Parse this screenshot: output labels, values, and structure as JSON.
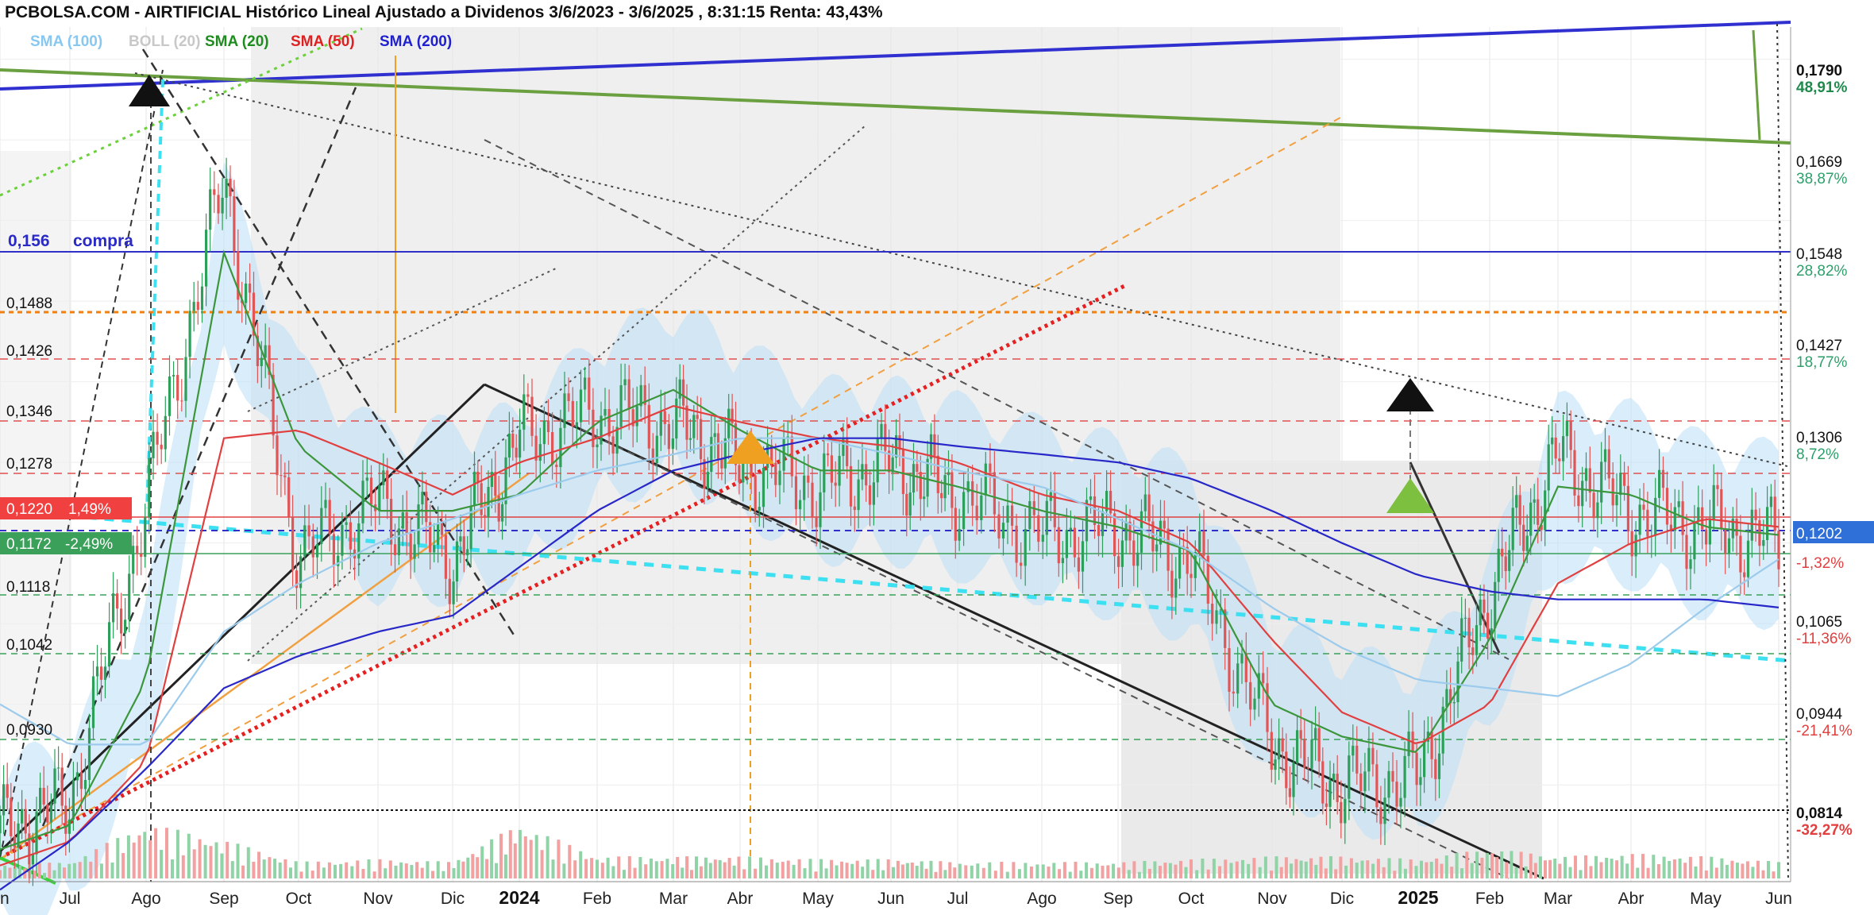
{
  "header": {
    "title": "PCBOLSA.COM - AIRTIFICIAL Histórico Lineal Ajustado a Dividenos 3/6/2023 - 3/6/2025 , 8:31:15 Renta: 43,43%"
  },
  "legend": [
    {
      "label": "SMA (100)",
      "color": "#87c8f0"
    },
    {
      "label": "BOLL (20)",
      "color": "#c8c8c8"
    },
    {
      "label": "SMA (20)",
      "color": "#1e8c1e"
    },
    {
      "label": "SMA (50)",
      "color": "#e02020"
    },
    {
      "label": "SMA (200)",
      "color": "#2020d0"
    }
  ],
  "colors": {
    "up": "#2e9e5b",
    "down": "#e05555",
    "sma20": "#3c963c",
    "sma50": "#e04040",
    "sma100": "#9ccbec",
    "sma200": "#2828c8",
    "boll": "#bcdff7",
    "channel": "#d8d8d8"
  },
  "annotations": {
    "compra_price": "0,156",
    "compra_label": "compra",
    "last_price": "0,1202",
    "level_1220": "0,1220",
    "level_1220_pct": "1,49%",
    "level_1172": "0,1172",
    "level_1172_pct": "-2,49%"
  },
  "right_axis": [
    {
      "price": "0,1790",
      "pct": "48,91%",
      "pct_color": "#1f8a4c",
      "bold": true
    },
    {
      "price": "0,1669",
      "pct": "38,87%",
      "pct_color": "#2e9e6a",
      "bold": false
    },
    {
      "price": "0,1548",
      "pct": "28,82%",
      "pct_color": "#2e9e6a",
      "bold": false
    },
    {
      "price": "0,1427",
      "pct": "18,77%",
      "pct_color": "#2e9e6a",
      "bold": false
    },
    {
      "price": "0,1306",
      "pct": "8,72%",
      "pct_color": "#2e9e6a",
      "bold": false
    },
    {
      "price": "",
      "pct": "-1,32%",
      "pct_color": "#e04040",
      "bold": false
    },
    {
      "price": "0,1065",
      "pct": "-11,36%",
      "pct_color": "#e04040",
      "bold": false
    },
    {
      "price": "0,0944",
      "pct": "-21,41%",
      "pct_color": "#e04040",
      "bold": false
    },
    {
      "price": "0,0814",
      "pct": "-32,27%",
      "pct_color": "#e04040",
      "bold": true
    }
  ],
  "left_levels": [
    "0,1488",
    "0,1426",
    "0,1346",
    "0,1278",
    "0,1118",
    "0,1042",
    "0,0930"
  ],
  "x_axis": [
    {
      "label": "n",
      "year": false
    },
    {
      "label": "Jul",
      "year": false
    },
    {
      "label": "Ago",
      "year": false
    },
    {
      "label": "Sep",
      "year": false
    },
    {
      "label": "Oct",
      "year": false
    },
    {
      "label": "Nov",
      "year": false
    },
    {
      "label": "Dic",
      "year": false
    },
    {
      "label": "2024",
      "year": true
    },
    {
      "label": "Feb",
      "year": false
    },
    {
      "label": "Mar",
      "year": false
    },
    {
      "label": "Abr",
      "year": false
    },
    {
      "label": "May",
      "year": false
    },
    {
      "label": "Jun",
      "year": false
    },
    {
      "label": "Jul",
      "year": false
    },
    {
      "label": "Ago",
      "year": false
    },
    {
      "label": "Sep",
      "year": false
    },
    {
      "label": "Oct",
      "year": false
    },
    {
      "label": "Nov",
      "year": false
    },
    {
      "label": "Dic",
      "year": false
    },
    {
      "label": "2025",
      "year": true
    },
    {
      "label": "Feb",
      "year": false
    },
    {
      "label": "Mar",
      "year": false
    },
    {
      "label": "Abr",
      "year": false
    },
    {
      "label": "May",
      "year": false
    },
    {
      "label": "Jun",
      "year": false
    }
  ],
  "chart_data": {
    "type": "line",
    "ylim": [
      0.078,
      0.184
    ],
    "last": 0.1202,
    "dates": [
      "2023-06-05",
      "2023-07-03",
      "2023-08-01",
      "2023-09-01",
      "2023-10-02",
      "2023-11-01",
      "2023-12-01",
      "2024-01-02",
      "2024-02-01",
      "2024-03-01",
      "2024-04-01",
      "2024-05-02",
      "2024-06-03",
      "2024-07-01",
      "2024-08-01",
      "2024-09-02",
      "2024-10-01",
      "2024-11-01",
      "2024-12-02",
      "2025-01-02",
      "2025-02-03",
      "2025-03-03",
      "2025-04-01",
      "2025-05-02",
      "2025-06-02"
    ],
    "series": [
      {
        "name": "AIRTIFICIAL",
        "values": [
          0.084,
          0.088,
          0.125,
          0.165,
          0.118,
          0.125,
          0.118,
          0.133,
          0.136,
          0.135,
          0.13,
          0.127,
          0.13,
          0.126,
          0.121,
          0.122,
          0.118,
          0.095,
          0.09,
          0.091,
          0.114,
          0.131,
          0.124,
          0.122,
          0.1202
        ]
      },
      {
        "name": "SMA (20)",
        "values": [
          0.082,
          0.085,
          0.103,
          0.156,
          0.132,
          0.124,
          0.124,
          0.126,
          0.135,
          0.139,
          0.134,
          0.129,
          0.129,
          0.127,
          0.124,
          0.122,
          0.119,
          0.1,
          0.096,
          0.094,
          0.108,
          0.127,
          0.126,
          0.122,
          0.121
        ]
      },
      {
        "name": "SMA (50)",
        "values": [
          0.08,
          0.083,
          0.093,
          0.133,
          0.134,
          0.13,
          0.126,
          0.13,
          0.133,
          0.137,
          0.135,
          0.133,
          0.132,
          0.13,
          0.126,
          0.124,
          0.12,
          0.108,
          0.099,
          0.095,
          0.1,
          0.115,
          0.12,
          0.123,
          0.122
        ]
      },
      {
        "name": "SMA (100)",
        "values": [
          0.1,
          0.095,
          0.095,
          0.109,
          0.115,
          0.12,
          0.123,
          0.126,
          0.129,
          0.131,
          0.133,
          0.133,
          0.131,
          0.129,
          0.127,
          0.123,
          0.119,
          0.112,
          0.107,
          0.103,
          0.102,
          0.101,
          0.105,
          0.112,
          0.118
        ]
      },
      {
        "name": "SMA (200)",
        "values": [
          0.077,
          0.083,
          0.092,
          0.102,
          0.106,
          0.109,
          0.111,
          0.117,
          0.124,
          0.129,
          0.131,
          0.133,
          0.133,
          0.132,
          0.131,
          0.13,
          0.128,
          0.124,
          0.12,
          0.116,
          0.114,
          0.113,
          0.113,
          0.113,
          0.112
        ]
      }
    ],
    "volume": [
      0.25,
      0.3,
      1.0,
      0.7,
      0.3,
      0.35,
      0.3,
      1.0,
      0.4,
      0.4,
      0.4,
      0.35,
      0.35,
      0.3,
      0.3,
      0.3,
      0.35,
      0.4,
      0.4,
      0.35,
      0.55,
      0.4,
      0.45,
      0.4,
      0.3
    ],
    "grid": true,
    "legend_position": "top-left"
  }
}
